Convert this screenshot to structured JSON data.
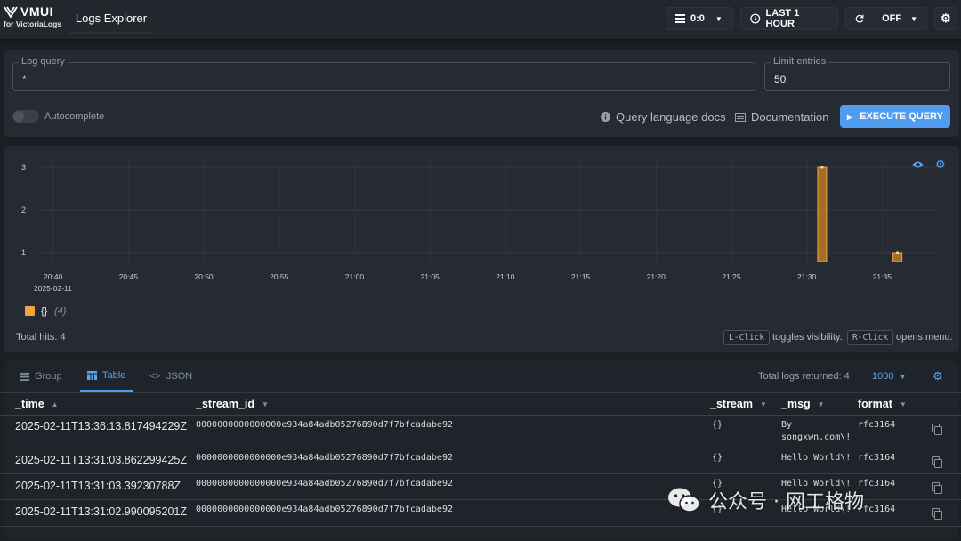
{
  "header": {
    "logo_text": "VMUI",
    "logo_sub": "for VictoriaLogs",
    "app_title": "Logs Explorer",
    "tenant": "0:0",
    "time_range": "LAST 1 HOUR",
    "refresh": "OFF"
  },
  "query": {
    "log_query_label": "Log query",
    "log_query_value": "*",
    "limit_label": "Limit entries",
    "limit_value": "50",
    "autocomplete_label": "Autocomplete",
    "query_docs_label": "Query language docs",
    "documentation_label": "Documentation",
    "execute_label": "EXECUTE QUERY"
  },
  "chart_data": {
    "type": "bar",
    "y_ticks": [
      "1",
      "2",
      "3"
    ],
    "x_ticks": [
      "20:40",
      "20:45",
      "20:50",
      "20:55",
      "21:00",
      "21:05",
      "21:10",
      "21:15",
      "21:20",
      "21:25",
      "21:30",
      "21:35"
    ],
    "x_date_label": "2025-02-11",
    "ylim": [
      0.8,
      3.2
    ],
    "bars": [
      {
        "time": "21:31",
        "value": 3
      },
      {
        "time": "21:36",
        "value": 1
      }
    ],
    "series": [
      {
        "name": "{}",
        "count": "(4)",
        "color": "#f3a53d"
      }
    ],
    "total_hits": "Total hits: 4",
    "hint_left_key": "L-Click",
    "hint_left_text": "toggles visibility.",
    "hint_right_key": "R-Click",
    "hint_right_text": "opens menu."
  },
  "results": {
    "tabs": [
      "Group",
      "Table",
      "JSON"
    ],
    "active_tab": "Table",
    "total_logs": "Total logs returned: 4",
    "limit": "1000",
    "columns": [
      "_time",
      "_stream_id",
      "_stream",
      "_msg",
      "format"
    ],
    "rows": [
      {
        "time": "2025-02-11T13:36:13.817494229Z",
        "stream_id": "0000000000000000e934a84adb05276890d7f7bfcadabe92",
        "stream": "{}",
        "msg_line1": "By",
        "msg_line2": "songxwn.com\\!",
        "format": "rfc3164"
      },
      {
        "time": "2025-02-11T13:31:03.862299425Z",
        "stream_id": "0000000000000000e934a84adb05276890d7f7bfcadabe92",
        "stream": "{}",
        "msg_line1": "Hello World\\!",
        "msg_line2": "",
        "format": "rfc3164"
      },
      {
        "time": "2025-02-11T13:31:03.39230788Z",
        "stream_id": "0000000000000000e934a84adb05276890d7f7bfcadabe92",
        "stream": "{}",
        "msg_line1": "Hello World\\!",
        "msg_line2": "",
        "format": "rfc3164"
      },
      {
        "time": "2025-02-11T13:31:02.990095201Z",
        "stream_id": "0000000000000000e934a84adb05276890d7f7bfcadabe92",
        "stream": "{}",
        "msg_line1": "Hello World\\!",
        "msg_line2": "",
        "format": "rfc3164"
      }
    ]
  },
  "watermark": "公众号 · 网工格物"
}
